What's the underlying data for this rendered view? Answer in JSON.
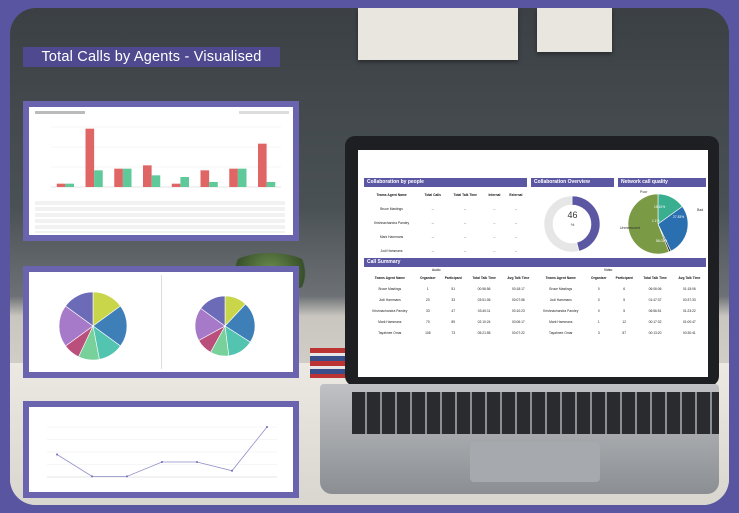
{
  "banner": {
    "title": "Total Calls by Agents - Visualised"
  },
  "bar_panel": {
    "chart_data": {
      "type": "bar",
      "categories": [
        "",
        "",
        "",
        "",
        "",
        "",
        "",
        ""
      ],
      "series": [
        {
          "name": "",
          "values": [
            0.2,
            3.5,
            1.1,
            1.3,
            0.2,
            1.0,
            1.1,
            2.6
          ],
          "color": "#e06666"
        },
        {
          "name": "",
          "values": [
            0.2,
            1.0,
            1.1,
            0.7,
            0.6,
            0.3,
            1.1,
            0.3
          ],
          "color": "#5fc99a"
        }
      ]
    }
  },
  "pie_panel": {
    "charts": [
      {
        "chart_data": {
          "type": "pie",
          "values": [
            15,
            20,
            12,
            10,
            8,
            20,
            15
          ],
          "colors": [
            "#c9d64a",
            "#3e7fb8",
            "#53c4b0",
            "#78d09a",
            "#b94f7a",
            "#a77ac9",
            "#6b6bb8"
          ]
        }
      },
      {
        "chart_data": {
          "type": "pie",
          "values": [
            12,
            22,
            14,
            10,
            9,
            18,
            15
          ],
          "colors": [
            "#c9d64a",
            "#3e7fb8",
            "#53c4b0",
            "#78d09a",
            "#b94f7a",
            "#a77ac9",
            "#6b6bb8"
          ]
        }
      }
    ]
  },
  "line_panel": {
    "chart_data": {
      "type": "line",
      "values": [
        18,
        0.5,
        0.5,
        12,
        12,
        5,
        40
      ],
      "ylim": [
        0,
        40
      ]
    }
  },
  "laptop": {
    "collab_people": {
      "title": "Collaboration by people",
      "headers": [
        "Teams Agent Name",
        "Total Calls",
        "Total Talk Time",
        "Internal",
        "External"
      ],
      "rows": [
        [
          "Bruce Mastings",
          "--",
          "--",
          "--",
          "--"
        ],
        [
          "Krishnachandra Pandey",
          "--",
          "--",
          "--",
          "--"
        ],
        [
          "Mark Hammans",
          "--",
          "--",
          "--",
          "--"
        ],
        [
          "Jodi Hammans",
          "--",
          "--",
          "--",
          "--"
        ],
        [
          "Tayahnee Omar",
          "--",
          "--",
          "--",
          "--"
        ]
      ]
    },
    "collab_overview": {
      "title": "Collaboration Overview",
      "value": "46",
      "unit": "%",
      "chart_data": {
        "type": "pie",
        "values": [
          46,
          54
        ],
        "colors": [
          "#5c57a3",
          "#e6e6e6"
        ]
      }
    },
    "network_quality": {
      "title": "Network call quality",
      "labels": [
        "Poor",
        "Bad",
        "Unmeasured",
        "Good"
      ],
      "percents": [
        "15.10%",
        "27.83%",
        "1.1%",
        "56.01%"
      ],
      "chart_data": {
        "type": "pie",
        "values": [
          15.1,
          27.83,
          1.1,
          56.01
        ],
        "colors": [
          "#3aaf8f",
          "#2a6fb0",
          "#2e2e2e",
          "#7a9a45"
        ]
      }
    },
    "call_summary": {
      "title": "Call Summary",
      "group_audio": "Audio",
      "group_video": "Video",
      "headers": [
        "Teams Agent Name",
        "Organiser",
        "Participant",
        "Total Talk Time",
        "Avg Talk Time",
        "Teams Agent Name",
        "Organiser",
        "Participant",
        "Total Talk Time",
        "Avg Talk Time"
      ],
      "rows": [
        [
          "Bruce Mastings",
          "1",
          "51",
          "00:56:56",
          "00:18:17",
          "Bruce Mastings",
          "0",
          "6",
          "06:06:06",
          "01:15:06"
        ],
        [
          "Jodi Hammans",
          "20",
          "33",
          "03:51:06",
          "00:07:56",
          "Jodi Hammans",
          "0",
          "5",
          "01:47:37",
          "00:37:33"
        ],
        [
          "Krishnachandra Pandey",
          "33",
          "47",
          "03:40:11",
          "00:10:23",
          "Krishnachandra Pandey",
          "0",
          "5",
          "06:56:51",
          "01:23:22"
        ],
        [
          "Mark Hammans",
          "70",
          "89",
          "02:10:24",
          "00:06:17",
          "Mark Hammans",
          "1",
          "12",
          "00:17:32",
          "01:00:47"
        ],
        [
          "Tayahnee Omar",
          "106",
          "73",
          "05:21:55",
          "00:07:22",
          "Tayahnee Omar",
          "3",
          "57",
          "00:13:20",
          "00:30:41"
        ]
      ]
    }
  }
}
